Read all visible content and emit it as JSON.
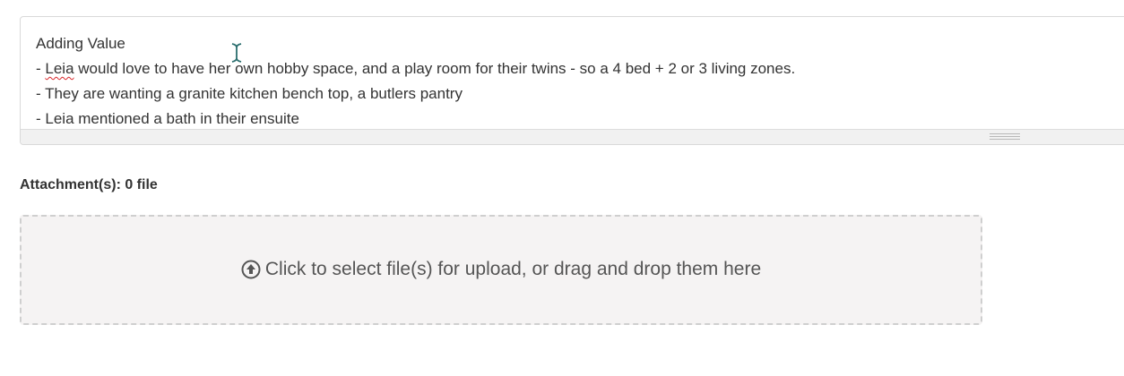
{
  "editor": {
    "lines": [
      {
        "prefix": "",
        "spell_error": "",
        "text": "Adding Value"
      },
      {
        "prefix": "- ",
        "spell_error": "Leia",
        "text": " would love to have her own hobby space, and a play room for their twins - so a 4 bed + 2 or 3 living zones."
      },
      {
        "prefix": "",
        "spell_error": "",
        "text": "- They are wanting a granite kitchen bench top, a butlers pantry"
      },
      {
        "prefix": "- ",
        "spell_error": "",
        "text": "Leia mentioned a bath in their ensuite"
      }
    ]
  },
  "attachments": {
    "label": "Attachment(s): 0 file"
  },
  "dropzone": {
    "icon": "upload-circle-icon",
    "text": "Click to select file(s) for upload, or drag and drop them here"
  }
}
